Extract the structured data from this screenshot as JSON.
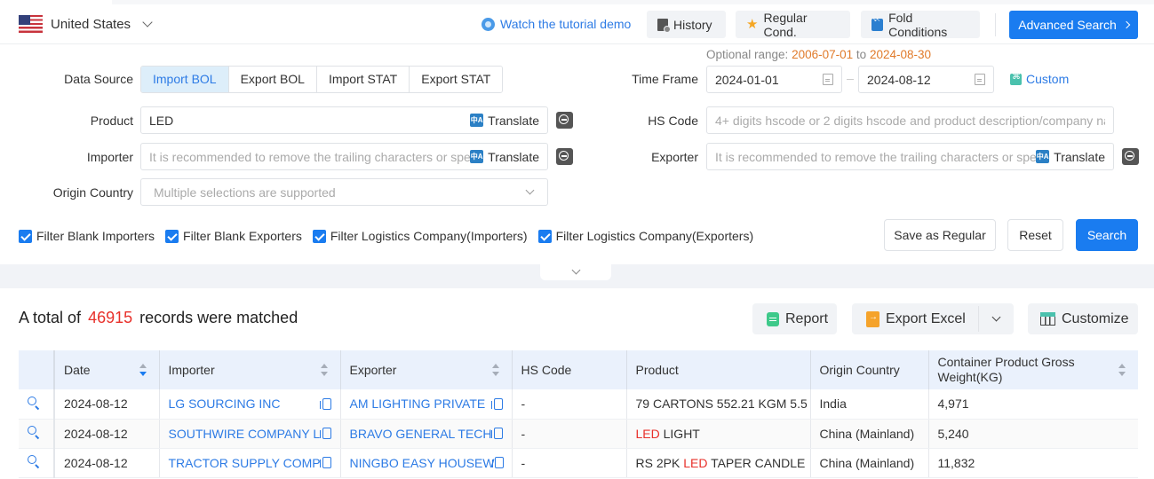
{
  "header": {
    "country": "United States",
    "tutorial_link": "Watch the tutorial demo",
    "history": "History",
    "regular_cond": "Regular Cond.",
    "fold_conditions": "Fold Conditions",
    "advanced_search": "Advanced Search"
  },
  "form": {
    "data_source_label": "Data Source",
    "data_sources": [
      "Import BOL",
      "Export BOL",
      "Import STAT",
      "Export STAT"
    ],
    "data_source_selected": "Import BOL",
    "optional_range_label": "Optional range:",
    "optional_range_start": "2006-07-01",
    "optional_range_to": "to",
    "optional_range_end": "2024-08-30",
    "time_frame_label": "Time Frame",
    "time_start": "2024-01-01",
    "time_end": "2024-08-12",
    "custom": "Custom",
    "product_label": "Product",
    "product_value": "LED",
    "translate": "Translate",
    "hs_code_label": "HS Code",
    "hs_code_placeholder": "4+ digits hscode or 2 digits hscode and product description/company na...",
    "importer_label": "Importer",
    "importer_placeholder": "It is recommended to remove the trailing characters or spe",
    "exporter_label": "Exporter",
    "exporter_placeholder": "It is recommended to remove the trailing characters or spe",
    "origin_label": "Origin Country",
    "origin_placeholder": "Multiple selections are supported"
  },
  "filters": [
    {
      "label": "Filter Blank Importers",
      "checked": true
    },
    {
      "label": "Filter Blank Exporters",
      "checked": true
    },
    {
      "label": "Filter Logistics Company(Importers)",
      "checked": true
    },
    {
      "label": "Filter Logistics Company(Exporters)",
      "checked": true
    }
  ],
  "actions": {
    "save_regular": "Save as Regular",
    "reset": "Reset",
    "search": "Search"
  },
  "results": {
    "prefix": "A total of",
    "count": "46915",
    "suffix": "records were matched",
    "report": "Report",
    "export_excel": "Export Excel",
    "customize": "Customize"
  },
  "table": {
    "columns": [
      "",
      "Date",
      "Importer",
      "Exporter",
      "HS Code",
      "Product",
      "Origin Country",
      "Container Product Gross Weight(KG)"
    ],
    "rows": [
      {
        "date": "2024-08-12",
        "importer": "LG SOURCING INC",
        "exporter": "AM LIGHTING PRIVATE",
        "hs_code": "-",
        "product_pre": "79 CARTONS 552.21 KGM 5.5",
        "product_hl": "",
        "product_post": "",
        "origin": "India",
        "weight": "4,971"
      },
      {
        "date": "2024-08-12",
        "importer": "SOUTHWIRE COMPANY L",
        "exporter": "BRAVO GENERAL TECH",
        "hs_code": "-",
        "product_pre": "",
        "product_hl": "LED",
        "product_post": " LIGHT",
        "origin": "China (Mainland)",
        "weight": "5,240"
      },
      {
        "date": "2024-08-12",
        "importer": "TRACTOR SUPPLY COMP",
        "exporter": "NINGBO EASY HOUSEW",
        "hs_code": "-",
        "product_pre": "RS 2PK ",
        "product_hl": "LED",
        "product_post": " TAPER CANDLE",
        "origin": "China (Mainland)",
        "weight": "11,832"
      }
    ]
  },
  "colors": {
    "primary": "#1a7cf0",
    "link": "#2d7be5",
    "highlight": "#e8302a",
    "range": "#e07a2a"
  }
}
